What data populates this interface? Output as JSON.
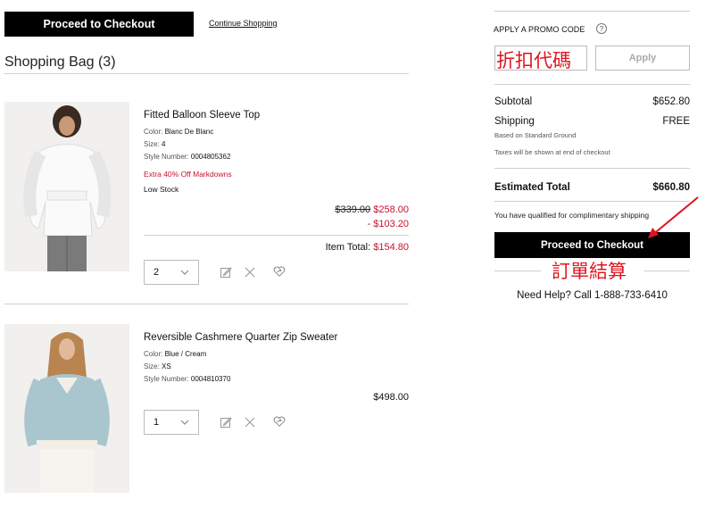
{
  "header": {
    "checkout_label": "Proceed to Checkout",
    "continue_label": "Continue Shopping"
  },
  "bag": {
    "title": "Shopping Bag (3)"
  },
  "items": [
    {
      "name": "Fitted Balloon Sleeve Top",
      "color_label": "Color: ",
      "color": "Blanc De Blanc",
      "size_label": "Size: ",
      "size": "4",
      "style_label": "Style Number: ",
      "style": "0004805362",
      "promo": "Extra 40% Off Markdowns",
      "stock": "Low Stock",
      "original_price": "$339.00",
      "sale_price": "$258.00",
      "discount": "- $103.20",
      "total_label": "Item Total: ",
      "total": "$154.80",
      "qty": "2"
    },
    {
      "name": "Reversible Cashmere Quarter Zip Sweater",
      "color_label": "Color: ",
      "color": "Blue / Cream",
      "size_label": "Size: ",
      "size": "XS",
      "style_label": "Style Number: ",
      "style": "0004810370",
      "price": "$498.00",
      "qty": "1"
    }
  ],
  "promo": {
    "label": "APPLY A PROMO CODE",
    "help": "?",
    "apply_label": "Apply",
    "overlay_text": "折扣代碼"
  },
  "summary": {
    "subtotal_label": "Subtotal",
    "subtotal": "$652.80",
    "shipping_label": "Shipping",
    "shipping": "FREE",
    "shipping_note": "Based on Standard Ground",
    "tax_note": "Taxes will be shown at end of checkout",
    "estimated_label": "Estimated Total",
    "estimated": "$660.80",
    "qualified_note": "You have qualified for complimentary shipping",
    "checkout_label": "Proceed to Checkout",
    "overlay_text": "訂單結算",
    "help_text": "Need Help? Call 1-888-733-6410"
  },
  "colors": {
    "accent_red": "#c8102e",
    "annotation_red": "#e0141e",
    "button_black": "#000000"
  }
}
